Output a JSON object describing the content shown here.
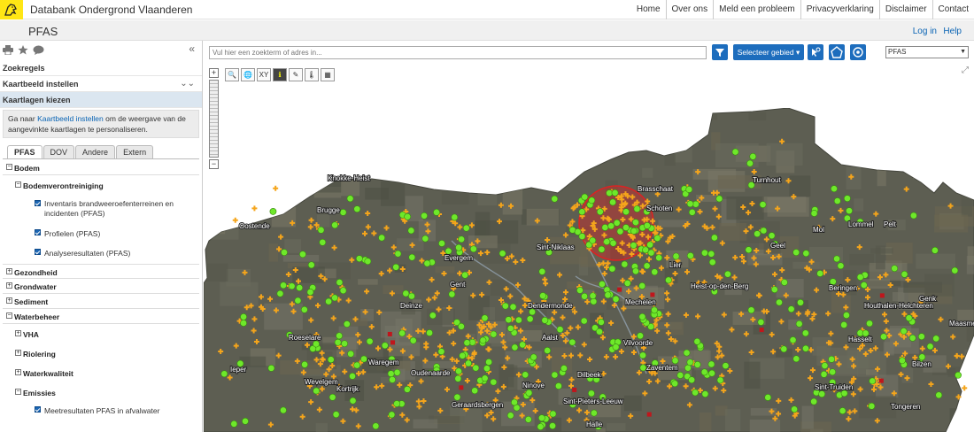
{
  "app_title": "Databank Ondergrond Vlaanderen",
  "top_nav": [
    "Home",
    "Over ons",
    "Meld een probleem",
    "Privacyverklaring",
    "Disclaimer",
    "Contact"
  ],
  "page_title": "PFAS",
  "login_label": "Log in",
  "help_label": "Help",
  "sidebar": {
    "collapse_icon": "«",
    "expand_icon": "»",
    "rows": [
      "Zoekregels",
      "Kaartbeeld instellen",
      "Kaartlagen kiezen"
    ],
    "info_prefix": "Ga naar ",
    "info_link": "Kaartbeeld instellen",
    "info_suffix": " om de weergave van de aangevinkte kaartlagen te personaliseren.",
    "tabs": [
      "PFAS",
      "DOV",
      "Andere",
      "Extern"
    ],
    "tree": {
      "bodem": "Bodem",
      "bodemverontreiniging": "Bodemverontreiniging",
      "leaf1": "Inventaris brandweeroefenterreinen en incidenten (PFAS)",
      "leaf2": "Profielen (PFAS)",
      "leaf3": "Analyseresultaten (PFAS)",
      "gezondheid": "Gezondheid",
      "grondwater": "Grondwater",
      "sediment": "Sediment",
      "waterbeheer": "Waterbeheer",
      "vha": "VHA",
      "riolering": "Riolering",
      "waterkwaliteit": "Waterkwaliteit",
      "emissies": "Emissies",
      "leaf4": "Meetresultaten PFAS in afvalwater"
    }
  },
  "map": {
    "search_placeholder": "Vul hier een zoekterm of adres in...",
    "select_area_label": "Selecteer gebied",
    "layer_select_value": "PFAS",
    "toolbar": [
      "🔍",
      "🌐",
      "XY",
      "ℹ",
      "✎",
      "🌡",
      "▦"
    ],
    "places": [
      {
        "name": "Knokke-Heist"
      },
      {
        "name": "Brugge"
      },
      {
        "name": "Oostende"
      },
      {
        "name": "Brasschaat"
      },
      {
        "name": "Schoten"
      },
      {
        "name": "Turnhout"
      },
      {
        "name": "Sint-Niklaas"
      },
      {
        "name": "Evergem"
      },
      {
        "name": "Gent"
      },
      {
        "name": "Lier"
      },
      {
        "name": "Geel"
      },
      {
        "name": "Mol"
      },
      {
        "name": "Lommel"
      },
      {
        "name": "Pelt"
      },
      {
        "name": "Heist-op-den-Berg"
      },
      {
        "name": "Deinze"
      },
      {
        "name": "Dendermonde"
      },
      {
        "name": "Mechelen"
      },
      {
        "name": "Beringen"
      },
      {
        "name": "Houthalen-Helchteren"
      },
      {
        "name": "Genk"
      },
      {
        "name": "Maasmechelen"
      },
      {
        "name": "Roeselare"
      },
      {
        "name": "Aalst"
      },
      {
        "name": "Vilvoorde"
      },
      {
        "name": "Hasselt"
      },
      {
        "name": "Ieper"
      },
      {
        "name": "Waregem"
      },
      {
        "name": "Oudenaarde"
      },
      {
        "name": "Zaventem"
      },
      {
        "name": "Bilzen"
      },
      {
        "name": "Wevelgem"
      },
      {
        "name": "Kortrijk"
      },
      {
        "name": "Ninove"
      },
      {
        "name": "Dilbeek"
      },
      {
        "name": "Sint-Truiden"
      },
      {
        "name": "Geraardsbergen"
      },
      {
        "name": "Sint-Pieters-Leeuw"
      },
      {
        "name": "Tongeren"
      },
      {
        "name": "Halle"
      }
    ],
    "colors": {
      "green": "#6ee82a",
      "orange": "#f5a51b",
      "red": "#c0161c",
      "map_bg": "#5d5e52"
    }
  }
}
